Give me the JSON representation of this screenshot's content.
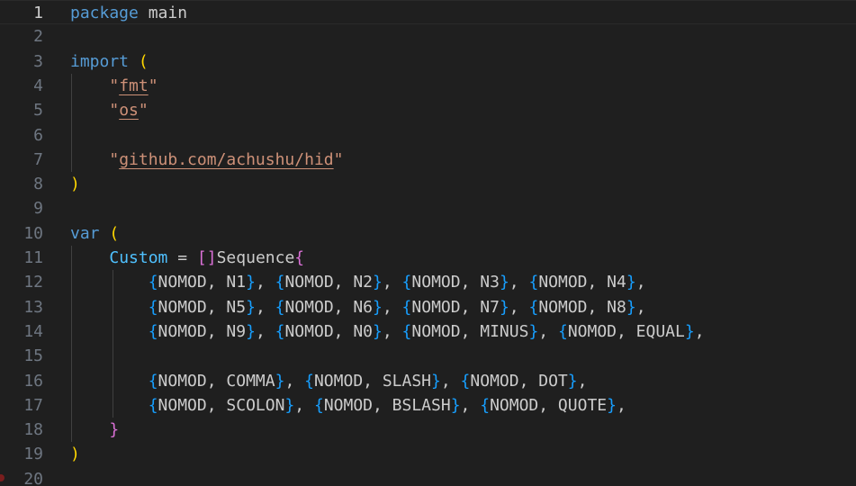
{
  "editor": {
    "lines": [
      {
        "num": "1",
        "tokens": [
          [
            "kw",
            "package"
          ],
          [
            "ident",
            " main"
          ]
        ]
      },
      {
        "num": "2",
        "tokens": []
      },
      {
        "num": "3",
        "tokens": [
          [
            "kw",
            "import"
          ],
          [
            "ident",
            " "
          ],
          [
            "b1",
            "("
          ]
        ]
      },
      {
        "num": "4",
        "tokens": [
          [
            "ident",
            "    "
          ],
          [
            "strq",
            "\""
          ],
          [
            "pkg",
            "fmt"
          ],
          [
            "strq",
            "\""
          ]
        ]
      },
      {
        "num": "5",
        "tokens": [
          [
            "ident",
            "    "
          ],
          [
            "strq",
            "\""
          ],
          [
            "pkg",
            "os"
          ],
          [
            "strq",
            "\""
          ]
        ]
      },
      {
        "num": "6",
        "tokens": []
      },
      {
        "num": "7",
        "tokens": [
          [
            "ident",
            "    "
          ],
          [
            "strq",
            "\""
          ],
          [
            "pkg",
            "github.com/achushu/hid"
          ],
          [
            "strq",
            "\""
          ]
        ]
      },
      {
        "num": "8",
        "tokens": [
          [
            "b1",
            ")"
          ]
        ]
      },
      {
        "num": "9",
        "tokens": []
      },
      {
        "num": "10",
        "tokens": [
          [
            "kw",
            "var"
          ],
          [
            "ident",
            " "
          ],
          [
            "b1",
            "("
          ]
        ]
      },
      {
        "num": "11",
        "tokens": [
          [
            "ident",
            "    "
          ],
          [
            "var",
            "Custom"
          ],
          [
            "op",
            " = "
          ],
          [
            "b2",
            "[]"
          ],
          [
            "type",
            "Sequence"
          ],
          [
            "b2",
            "{"
          ]
        ]
      },
      {
        "num": "12",
        "tokens": [
          [
            "ident",
            "        "
          ],
          [
            "b3",
            "{"
          ],
          [
            "const",
            "NOMOD, N1"
          ],
          [
            "b3",
            "}"
          ],
          [
            "op",
            ", "
          ],
          [
            "b3",
            "{"
          ],
          [
            "const",
            "NOMOD, N2"
          ],
          [
            "b3",
            "}"
          ],
          [
            "op",
            ", "
          ],
          [
            "b3",
            "{"
          ],
          [
            "const",
            "NOMOD, N3"
          ],
          [
            "b3",
            "}"
          ],
          [
            "op",
            ", "
          ],
          [
            "b3",
            "{"
          ],
          [
            "const",
            "NOMOD, N4"
          ],
          [
            "b3",
            "}"
          ],
          [
            "op",
            ","
          ]
        ]
      },
      {
        "num": "13",
        "tokens": [
          [
            "ident",
            "        "
          ],
          [
            "b3",
            "{"
          ],
          [
            "const",
            "NOMOD, N5"
          ],
          [
            "b3",
            "}"
          ],
          [
            "op",
            ", "
          ],
          [
            "b3",
            "{"
          ],
          [
            "const",
            "NOMOD, N6"
          ],
          [
            "b3",
            "}"
          ],
          [
            "op",
            ", "
          ],
          [
            "b3",
            "{"
          ],
          [
            "const",
            "NOMOD, N7"
          ],
          [
            "b3",
            "}"
          ],
          [
            "op",
            ", "
          ],
          [
            "b3",
            "{"
          ],
          [
            "const",
            "NOMOD, N8"
          ],
          [
            "b3",
            "}"
          ],
          [
            "op",
            ","
          ]
        ]
      },
      {
        "num": "14",
        "tokens": [
          [
            "ident",
            "        "
          ],
          [
            "b3",
            "{"
          ],
          [
            "const",
            "NOMOD, N9"
          ],
          [
            "b3",
            "}"
          ],
          [
            "op",
            ", "
          ],
          [
            "b3",
            "{"
          ],
          [
            "const",
            "NOMOD, N0"
          ],
          [
            "b3",
            "}"
          ],
          [
            "op",
            ", "
          ],
          [
            "b3",
            "{"
          ],
          [
            "const",
            "NOMOD, MINUS"
          ],
          [
            "b3",
            "}"
          ],
          [
            "op",
            ", "
          ],
          [
            "b3",
            "{"
          ],
          [
            "const",
            "NOMOD, EQUAL"
          ],
          [
            "b3",
            "}"
          ],
          [
            "op",
            ","
          ]
        ]
      },
      {
        "num": "15",
        "tokens": []
      },
      {
        "num": "16",
        "tokens": [
          [
            "ident",
            "        "
          ],
          [
            "b3",
            "{"
          ],
          [
            "const",
            "NOMOD, COMMA"
          ],
          [
            "b3",
            "}"
          ],
          [
            "op",
            ", "
          ],
          [
            "b3",
            "{"
          ],
          [
            "const",
            "NOMOD, SLASH"
          ],
          [
            "b3",
            "}"
          ],
          [
            "op",
            ", "
          ],
          [
            "b3",
            "{"
          ],
          [
            "const",
            "NOMOD, DOT"
          ],
          [
            "b3",
            "}"
          ],
          [
            "op",
            ","
          ]
        ]
      },
      {
        "num": "17",
        "tokens": [
          [
            "ident",
            "        "
          ],
          [
            "b3",
            "{"
          ],
          [
            "const",
            "NOMOD, SCOLON"
          ],
          [
            "b3",
            "}"
          ],
          [
            "op",
            ", "
          ],
          [
            "b3",
            "{"
          ],
          [
            "const",
            "NOMOD, BSLASH"
          ],
          [
            "b3",
            "}"
          ],
          [
            "op",
            ", "
          ],
          [
            "b3",
            "{"
          ],
          [
            "const",
            "NOMOD, QUOTE"
          ],
          [
            "b3",
            "}"
          ],
          [
            "op",
            ","
          ]
        ]
      },
      {
        "num": "18",
        "tokens": [
          [
            "ident",
            "    "
          ],
          [
            "b2",
            "}"
          ]
        ]
      },
      {
        "num": "19",
        "tokens": [
          [
            "b1",
            ")"
          ]
        ]
      },
      {
        "num": "20",
        "tokens": []
      }
    ],
    "current_line": "1",
    "colors": {
      "background": "#1f1f1f",
      "keyword": "#569cd6",
      "string": "#ce9178",
      "variable": "#4fc1ff",
      "bracket_level1": "#ffd700",
      "bracket_level2": "#da70d6",
      "bracket_level3": "#179fff"
    }
  }
}
